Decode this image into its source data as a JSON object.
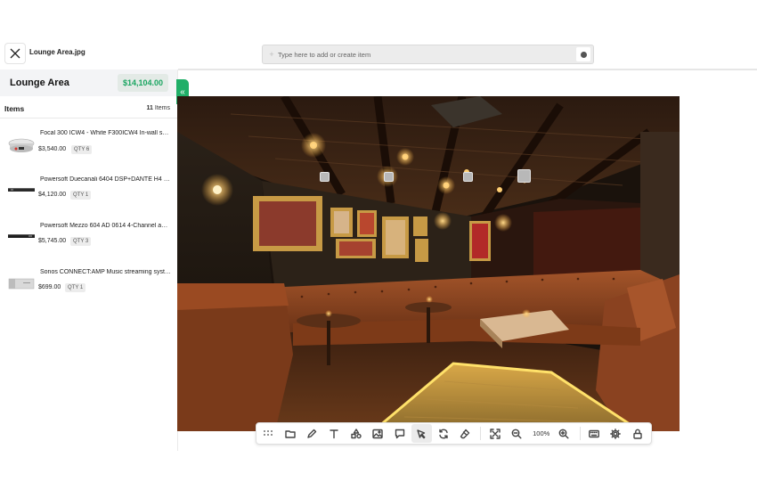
{
  "header": {
    "file_name": "Lounge Area.jpg",
    "search_placeholder": "Type here to add or create item"
  },
  "sidebar": {
    "project_title": "Lounge Area",
    "project_total": "$14,104.00",
    "items_title": "Items",
    "items_count": "11",
    "items_count_suffix": "Items",
    "items": [
      {
        "name": "Focal 300 ICW4 - White F300ICW4 In-wall speaker",
        "price": "$3,540.00",
        "qty": "QTY 6",
        "thumb": "ceiling-speaker"
      },
      {
        "name": "Powersoft Duecanali 6404 DSP+DANTE H4 amplifier",
        "price": "$4,120.00",
        "qty": "QTY 1",
        "thumb": "rack-amplifier"
      },
      {
        "name": "Powersoft Mezzo 604 AD 0614 4-Channel amplifier",
        "price": "$5,745.00",
        "qty": "QTY 3",
        "thumb": "rack-amplifier"
      },
      {
        "name": "Sonos CONNECT:AMP Music streaming system",
        "price": "$699.00",
        "qty": "QTY 1",
        "thumb": "sonos-amp"
      }
    ]
  },
  "toolbar": {
    "zoom": "100%",
    "tools": [
      "grid-icon",
      "folder-icon",
      "pen-icon",
      "text-icon",
      "shapes-icon",
      "image-icon",
      "comment-icon",
      "pointer-icon",
      "rotate-icon",
      "eraser-icon",
      "fit-screen-icon",
      "zoom-out-icon",
      "zoom-in-icon",
      "keyboard-icon",
      "settings-icon",
      "lock-icon"
    ],
    "active_tool": "pointer-icon"
  },
  "colors": {
    "accent_green": "#1fae67",
    "price_green": "#1aa561"
  }
}
